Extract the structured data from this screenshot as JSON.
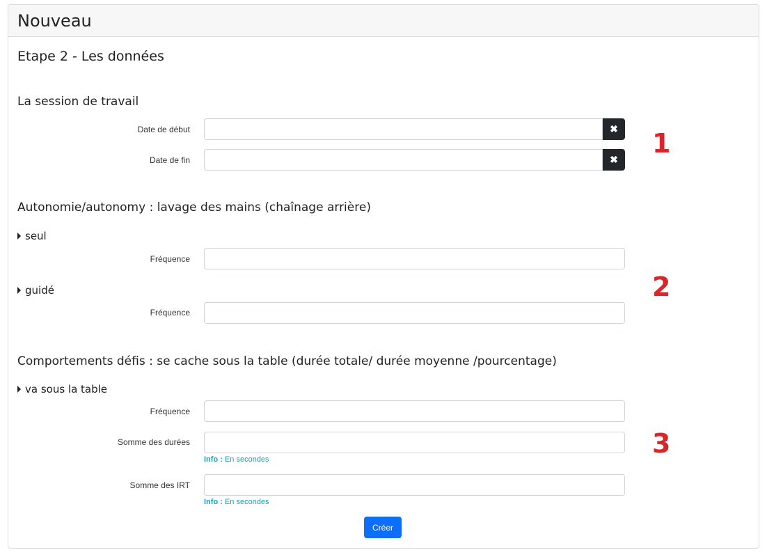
{
  "header": {
    "title": "Nouveau"
  },
  "step_title": "Etape 2 - Les données",
  "session": {
    "title": "La session de travail",
    "start_label": "Date de début",
    "end_label": "Date de fin",
    "clear_glyph": "✖"
  },
  "autonomie": {
    "title": "Autonomie/autonomy : lavage des mains (chaînage arrière)",
    "seul": {
      "label": "seul",
      "freq_label": "Fréquence"
    },
    "guide": {
      "label": "guidé",
      "freq_label": "Fréquence"
    }
  },
  "comportements": {
    "title": "Comportements défis : se cache sous la table (durée totale/ durée moyenne /pourcentage)",
    "item": {
      "label": "va sous la table",
      "freq_label": "Fréquence",
      "sum_durations_label": "Somme des durées",
      "sum_irt_label": "Somme des IRT",
      "info_prefix": "Info :",
      "info_text": "En secondes"
    }
  },
  "annotations": {
    "n1": "1",
    "n2": "2",
    "n3": "3"
  },
  "submit_label": "Créer",
  "colors": {
    "accent": "#0d6efd",
    "info": "#17a2b8",
    "annotation": "#d9262b",
    "dark_button": "#23272b"
  },
  "icons": {
    "clear": "times-icon",
    "expand": "caret-right-icon"
  }
}
